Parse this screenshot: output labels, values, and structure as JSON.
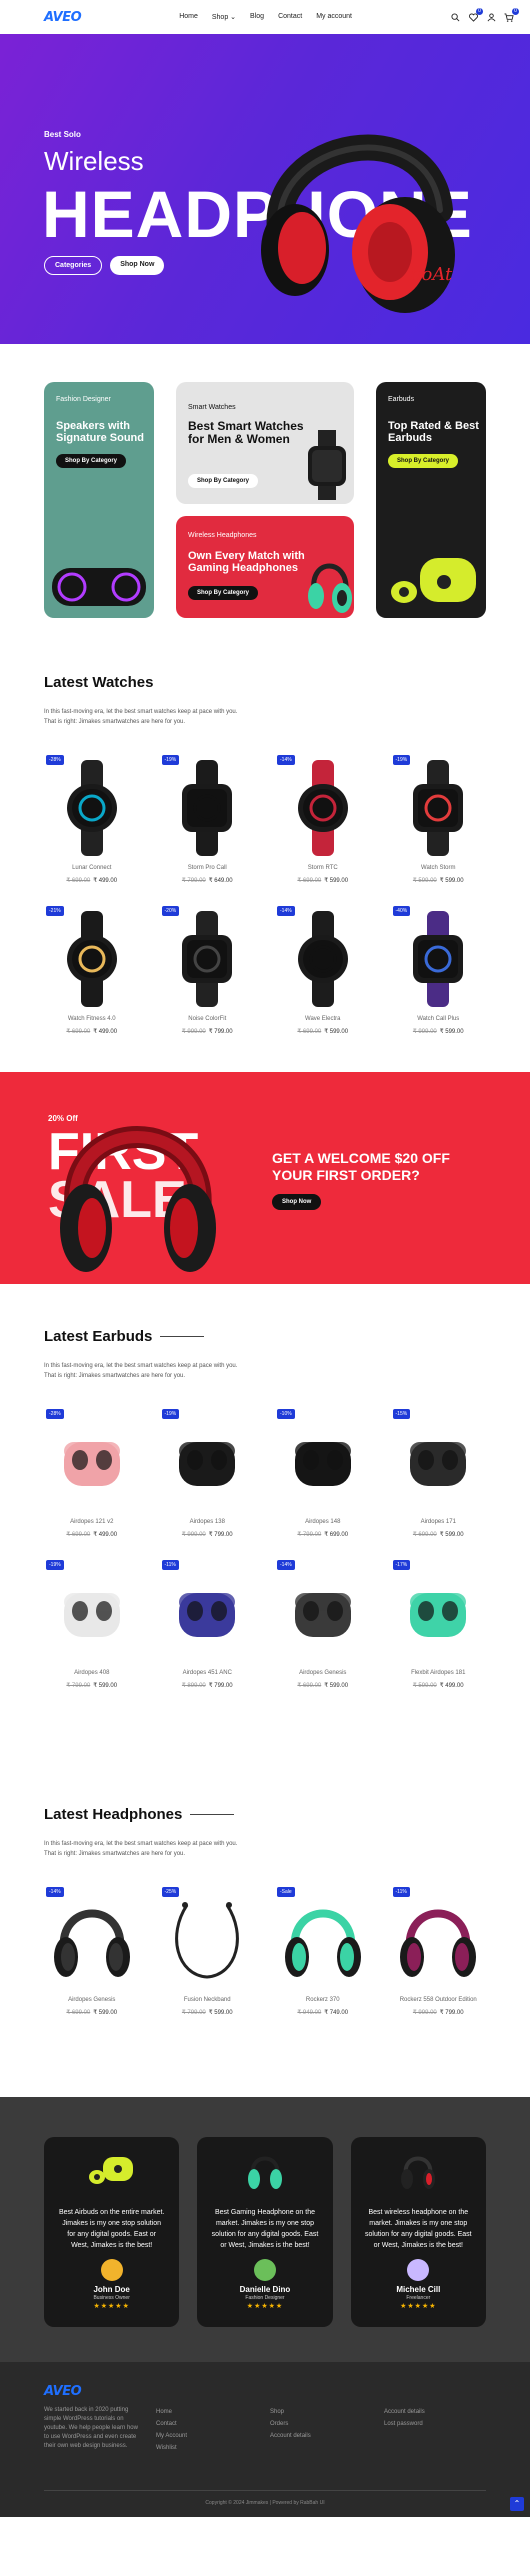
{
  "header": {
    "logo": "AVEO",
    "nav": [
      "Home",
      "Shop ⌄",
      "Blog",
      "Contact",
      "My account"
    ],
    "wishlist_count": "0",
    "cart_count": "0"
  },
  "hero": {
    "sub": "Best Solo",
    "title1": "Wireless",
    "title2": "HEADPHONE",
    "btn_categories": "Categories",
    "btn_shop": "Shop Now",
    "brand_on_product": "boAt"
  },
  "categories": [
    {
      "label": "Fashion Designer",
      "title": "Speakers with Signature Sound",
      "button": "Shop By Category"
    },
    {
      "label": "Smart Watches",
      "title": "Best Smart Watches for Men & Women",
      "button": "Shop By Category"
    },
    {
      "label": "Earbuds",
      "title": "Top Rated & Best Earbuds",
      "button": "Shop By Category"
    },
    {
      "label": "Wireless Headphones",
      "title": "Own Every Match with Gaming Headphones",
      "button": "Shop By Category"
    }
  ],
  "watches": {
    "title": "Latest Watches",
    "desc1": "In this fast-moving era, let the best smart watches keep at pace with you.",
    "desc2": "That is right: Jimakes smartwatches are here for you.",
    "items": [
      {
        "name": "Lunar Connect",
        "old": "₹ 699.00",
        "price": "₹ 499.00",
        "disc": "-28%"
      },
      {
        "name": "Storm Pro Call",
        "old": "₹ 799.00",
        "price": "₹ 649.00",
        "disc": "-19%"
      },
      {
        "name": "Storm RTC",
        "old": "₹ 699.00",
        "price": "₹ 599.00",
        "disc": "-14%"
      },
      {
        "name": "Watch Storm",
        "old": "₹ 599.00",
        "price": "₹ 599.00",
        "disc": "-19%"
      },
      {
        "name": "Watch Fitness 4.0",
        "old": "₹ 699.00",
        "price": "₹ 499.00",
        "disc": "-21%"
      },
      {
        "name": "Noise ColorFit",
        "old": "₹ 999.00",
        "price": "₹ 799.00",
        "disc": "-20%"
      },
      {
        "name": "Wave Electra",
        "old": "₹ 699.00",
        "price": "₹ 599.00",
        "disc": "-14%"
      },
      {
        "name": "Watch Call Plus",
        "old": "₹ 999.00",
        "price": "₹ 599.00",
        "disc": "-40%"
      }
    ]
  },
  "promo": {
    "small": "20% Off",
    "big1": "FIRST",
    "big2": "SALE",
    "headline1": "GET A WELCOME $20 OFF",
    "headline2": "YOUR FIRST ORDER?",
    "button": "Shop Now"
  },
  "earbuds": {
    "title": "Latest Earbuds",
    "desc1": "In this fast-moving era, let the best smart watches keep at pace with you.",
    "desc2": "That is right: Jimakes smartwatches are here for you.",
    "items": [
      {
        "name": "Airdopes 121 v2",
        "old": "₹ 699.00",
        "price": "₹ 499.00",
        "disc": "-28%"
      },
      {
        "name": "Airdopes 138",
        "old": "₹ 999.00",
        "price": "₹ 799.00",
        "disc": "-19%"
      },
      {
        "name": "Airdopes 148",
        "old": "₹ 799.00",
        "price": "₹ 699.00",
        "disc": "-10%"
      },
      {
        "name": "Airdopes 171",
        "old": "₹ 699.00",
        "price": "₹ 599.00",
        "disc": "-15%"
      },
      {
        "name": "Airdopes 408",
        "old": "₹ 799.00",
        "price": "₹ 599.00",
        "disc": "-19%"
      },
      {
        "name": "Airdopes 451 ANC",
        "old": "₹ 899.00",
        "price": "₹ 799.00",
        "disc": "-11%"
      },
      {
        "name": "Airdopes Genesis",
        "old": "₹ 699.00",
        "price": "₹ 599.00",
        "disc": "-14%"
      },
      {
        "name": "Flexbit Airdopes 181",
        "old": "₹ 599.00",
        "price": "₹ 499.00",
        "disc": "-17%"
      }
    ]
  },
  "headphones": {
    "title": "Latest Headphones",
    "desc1": "In this fast-moving era, let the best smart watches keep at pace with you.",
    "desc2": "That is right: Jimakes smartwatches are here for you.",
    "items": [
      {
        "name": "Airdopes Genesis",
        "old": "₹ 699.00",
        "price": "₹ 599.00",
        "disc": "-14%"
      },
      {
        "name": "Fusion Neckband",
        "old": "₹ 799.00",
        "price": "₹ 599.00",
        "disc": "-25%"
      },
      {
        "name": "Rockerz 370",
        "old": "₹ 949.00",
        "price": "₹ 749.00",
        "disc": "-Sale"
      },
      {
        "name": "Rockerz 558 Outdoor Edition",
        "old": "₹ 999.00",
        "price": "₹ 799.00",
        "disc": "-11%"
      }
    ]
  },
  "testimonials": [
    {
      "quote": "Best Airbuds on the entire market. Jimakes is my one stop solution for any digital goods. East or West, Jimakes is the best!",
      "name": "John Doe",
      "role": "Business Owner"
    },
    {
      "quote": "Best Gaming Headphone on the market. Jimakes is my one stop solution for any digital goods. East or West, Jimakes is the best!",
      "name": "Danielle Dino",
      "role": "Fashion Designer"
    },
    {
      "quote": "Best wireless headphone on the market. Jimakes is my one stop solution for any digital goods. East or West, Jimakes is the best!",
      "name": "Michele Cill",
      "role": "Freelancer"
    }
  ],
  "stars": "★★★★★",
  "footer": {
    "about": "We started back in 2020 putting simple WordPress tutorials on youtube. We help people learn how to use WordPress and even create their own web design business.",
    "col1": [
      "Home",
      "Contact",
      "My Account",
      "Wishlist"
    ],
    "col2": [
      "Shop",
      "Orders",
      "Account details"
    ],
    "col3": [
      "Account details",
      "Lost password"
    ],
    "copyright": "Copyright © 2024 Jimmakes | Powered by RabBah UI"
  },
  "colors": {
    "accent": "#1f3bd8",
    "hero": "#5b27d8",
    "promo": "#ee2a3b"
  }
}
